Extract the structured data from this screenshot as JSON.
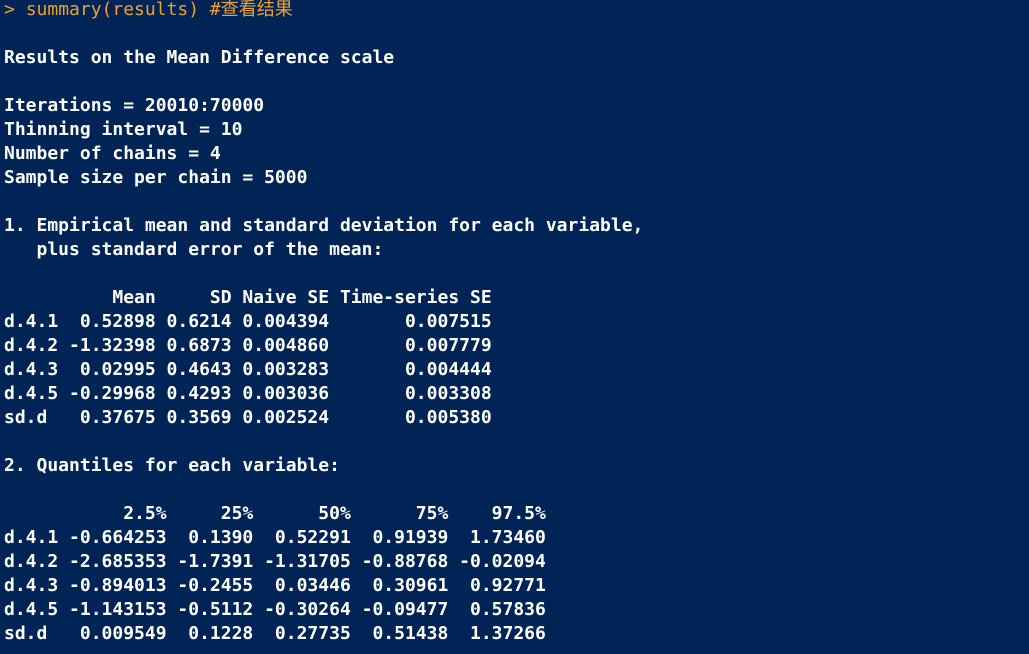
{
  "console": {
    "prompt": "> ",
    "command": "summary(results) #查看结果",
    "lines": [
      "",
      "Results on the Mean Difference scale",
      "",
      "Iterations = 20010:70000",
      "Thinning interval = 10",
      "Number of chains = 4",
      "Sample size per chain = 5000",
      "",
      "1. Empirical mean and standard deviation for each variable,",
      "   plus standard error of the mean:",
      "",
      "          Mean     SD Naive SE Time-series SE",
      "d.4.1  0.52898 0.6214 0.004394       0.007515",
      "d.4.2 -1.32398 0.6873 0.004860       0.007779",
      "d.4.3  0.02995 0.4643 0.003283       0.004444",
      "d.4.5 -0.29968 0.4293 0.003036       0.003308",
      "sd.d   0.37675 0.3569 0.002524       0.005380",
      "",
      "2. Quantiles for each variable:",
      "",
      "           2.5%     25%      50%      75%    97.5%",
      "d.4.1 -0.664253  0.1390  0.52291  0.91939  1.73460",
      "d.4.2 -2.685353 -1.7391 -1.31705 -0.88768 -0.02094",
      "d.4.3 -0.894013 -0.2455  0.03446  0.30961  0.92771",
      "d.4.5 -1.143153 -0.5112 -0.30264 -0.09477  0.57836",
      "sd.d   0.009549  0.1228  0.27735  0.51438  1.37266"
    ]
  }
}
